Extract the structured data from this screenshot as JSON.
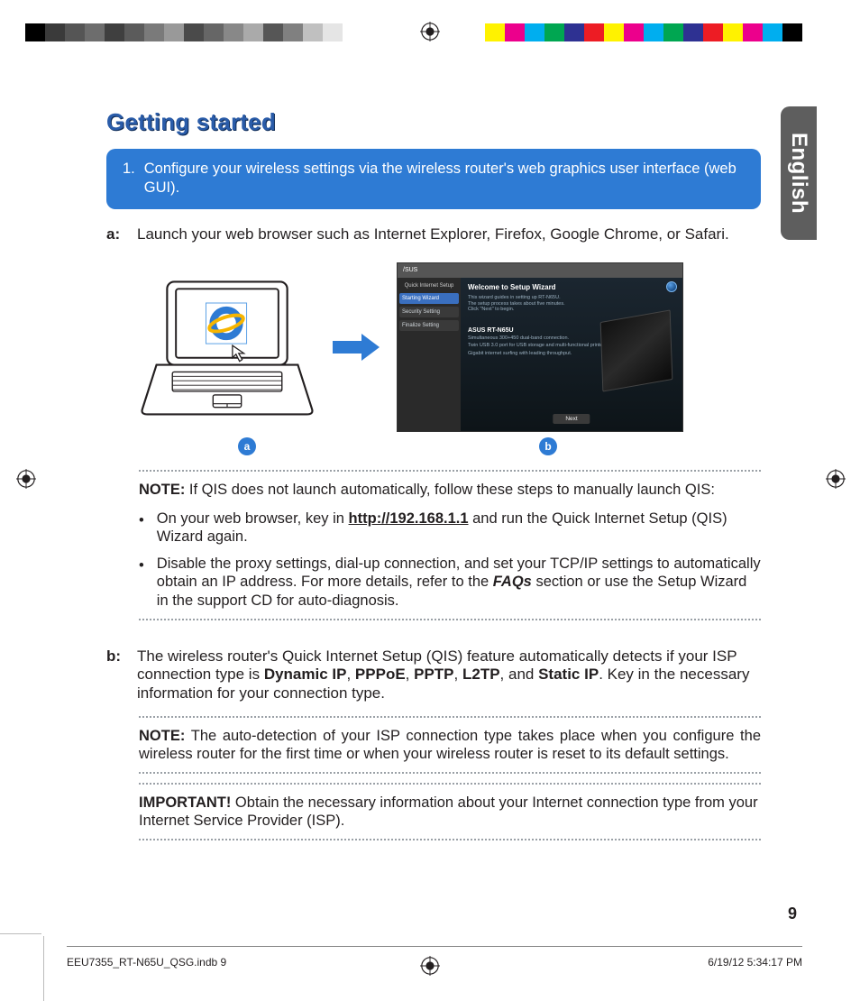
{
  "language_tab": "English",
  "title": "Getting started",
  "callout": {
    "number": "1.",
    "text": "Configure your wireless settings via the wireless router's web graphics user interface (web GUI)."
  },
  "step_a": {
    "label": "a:",
    "text": "Launch your web browser such as Internet  Explorer, Firefox, Google Chrome, or Safari."
  },
  "badges": {
    "a": "a",
    "b": "b"
  },
  "gui": {
    "brand": "/SUS",
    "side_head": "Quick Internet Setup",
    "side_items": [
      "Starting Wizard",
      "Security Setting",
      "Finalize Setting"
    ],
    "welcome": "Welcome to Setup Wizard",
    "sub1": "This wizard guides in setting up RT-N65U.",
    "sub2": "The setup process takes about five minutes.",
    "sub3": "Click \"Next\" to begin.",
    "model": "ASUS RT-N65U",
    "feat1": "Simultaneous 300+450 dual-band connection.",
    "feat2": "Twin USB 3.0 port for USB storage and multi-functional printer.",
    "feat3": "Gigabit internet surfing with leading throughput.",
    "next": "Next"
  },
  "note1": {
    "lead": "NOTE:",
    "text": " If QIS does not launch automatically, follow these steps to manually launch QIS:"
  },
  "bullets": {
    "b1_pre": "On your web browser, key in ",
    "b1_url": "http://192.168.1.1",
    "b1_post": " and run the Quick Internet Setup (QIS) Wizard again.",
    "b2_pre": "Disable the proxy settings, dial-up connection, and set your TCP/IP settings to automatically obtain an IP address. For more details, refer to the ",
    "b2_faq": "FAQs",
    "b2_post": " section or use the Setup Wizard in the support CD for auto-diagnosis."
  },
  "step_b": {
    "label": "b:",
    "pre": "The wireless router's Quick Internet Setup (QIS) feature automatically detects if your ISP connection type is ",
    "t1": "Dynamic IP",
    "c1": ", ",
    "t2": "PPPoE",
    "c2": ", ",
    "t3": "PPTP",
    "c3": ", ",
    "t4": "L2TP",
    "c4": ", and ",
    "t5": "Static IP",
    "post": ". Key in the necessary information for your connection type."
  },
  "note2": {
    "lead": "NOTE:",
    "text": " The auto-detection of your ISP connection type takes place when you configure the wireless router for the first time or when your wireless router is reset to its default settings."
  },
  "important": {
    "lead": "IMPORTANT!",
    "text": " Obtain the necessary information about your Internet connection type from your Internet Service Provider (ISP)."
  },
  "page_number": "9",
  "footer": {
    "left": "EEU7355_RT-N65U_QSG.indb   9",
    "right": "6/19/12   5:34:17 PM"
  }
}
